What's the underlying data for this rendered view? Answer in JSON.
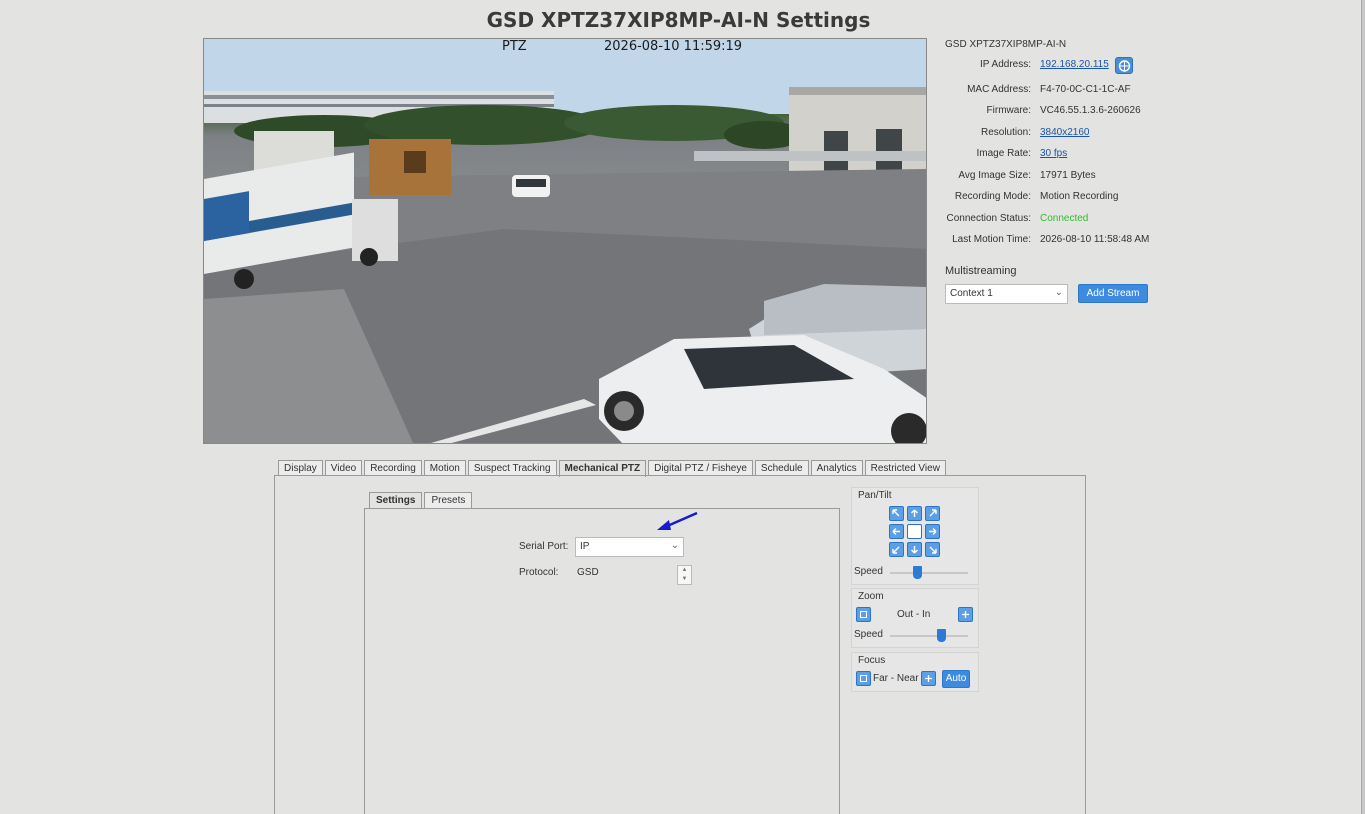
{
  "page": {
    "title": "GSD XPTZ37XIP8MP-AI-N Settings"
  },
  "feed": {
    "mode": "PTZ",
    "timestamp": "2026-08-10 11:59:19"
  },
  "info": {
    "device": "GSD XPTZ37XIP8MP-AI-N",
    "rows": [
      {
        "label": "IP Address:",
        "value": "192.168.20.115"
      },
      {
        "label": "MAC Address:",
        "value": "F4-70-0C-C1-1C-AF"
      },
      {
        "label": "Firmware:",
        "value": "VC46.55.1.3.6-260626"
      },
      {
        "label": "Resolution:",
        "value": "3840x2160"
      },
      {
        "label": "Image Rate:",
        "value": "30 fps"
      },
      {
        "label": "Avg Image Size:",
        "value": "17971 Bytes"
      },
      {
        "label": "Recording Mode:",
        "value": "Motion Recording"
      },
      {
        "label": "Connection Status:",
        "value": "Connected"
      },
      {
        "label": "Last Motion Time:",
        "value": "2026-08-10 11:58:48 AM"
      }
    ],
    "status_color": "#2ec02e",
    "link_color": "#1a55a8"
  },
  "multistream": {
    "label": "Multistreaming",
    "selected": "Context 1",
    "add_label": "Add Stream"
  },
  "tabs": [
    "Display",
    "Video",
    "Recording",
    "Motion",
    "Suspect Tracking",
    "Mechanical PTZ",
    "Digital PTZ / Fisheye",
    "Schedule",
    "Analytics",
    "Restricted View"
  ],
  "active_tab": "Mechanical PTZ",
  "subtabs": [
    "Settings",
    "Presets"
  ],
  "active_subtab": "Settings",
  "ptz_settings": {
    "serial_port_label": "Serial Port:",
    "serial_port_value": "IP",
    "protocol_label": "Protocol:",
    "protocol_value": "GSD"
  },
  "controls": {
    "pantilt_title": "Pan/Tilt",
    "speed_label": "Speed",
    "pantilt_speed": 0.35,
    "zoom_title": "Zoom",
    "zoom_text": "Out - In",
    "zoom_speed": 0.65,
    "focus_title": "Focus",
    "focus_text": "Far - Near",
    "auto_label": "Auto"
  },
  "accent_color": "#3d8be0"
}
